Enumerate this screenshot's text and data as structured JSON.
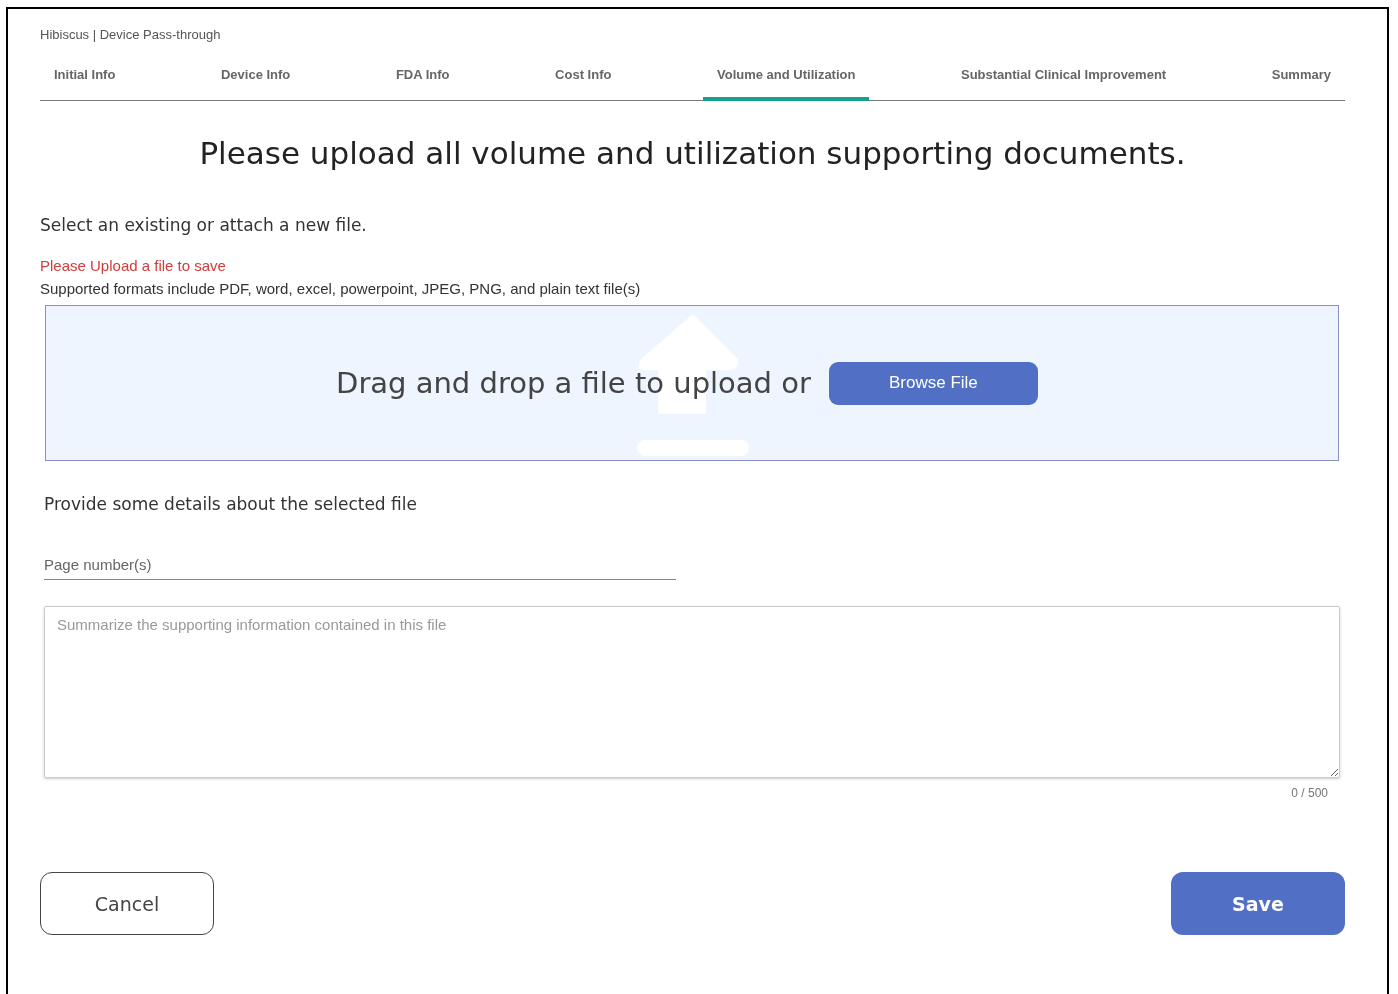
{
  "breadcrumb": "Hibiscus | Device Pass-through",
  "tabs": [
    {
      "label": "Initial Info",
      "selected": false
    },
    {
      "label": "Device Info",
      "selected": false
    },
    {
      "label": "FDA Info",
      "selected": false
    },
    {
      "label": "Cost Info",
      "selected": false
    },
    {
      "label": "Volume and Utilization",
      "selected": true
    },
    {
      "label": "Substantial Clinical Improvement",
      "selected": false
    },
    {
      "label": "Summary",
      "selected": false
    }
  ],
  "heading": "Please upload all volume and utilization supporting documents.",
  "instruction": "Select an existing or attach a new file.",
  "error": "Please Upload a file to save",
  "formats": "Supported formats include PDF, word, excel, powerpoint, JPEG, PNG, and plain text file(s)",
  "dropzone": {
    "text": "Drag and drop a file to upload or",
    "button": "Browse File"
  },
  "details_label": "Provide some details about the selected file",
  "page_field": {
    "placeholder": "Page number(s)"
  },
  "summary_field": {
    "placeholder": "Summarize the supporting information contained in this file",
    "counter": "0 / 500"
  },
  "actions": [
    {
      "label": "Cancel",
      "kind": "secondary"
    },
    {
      "label": "Save",
      "kind": "primary"
    }
  ]
}
